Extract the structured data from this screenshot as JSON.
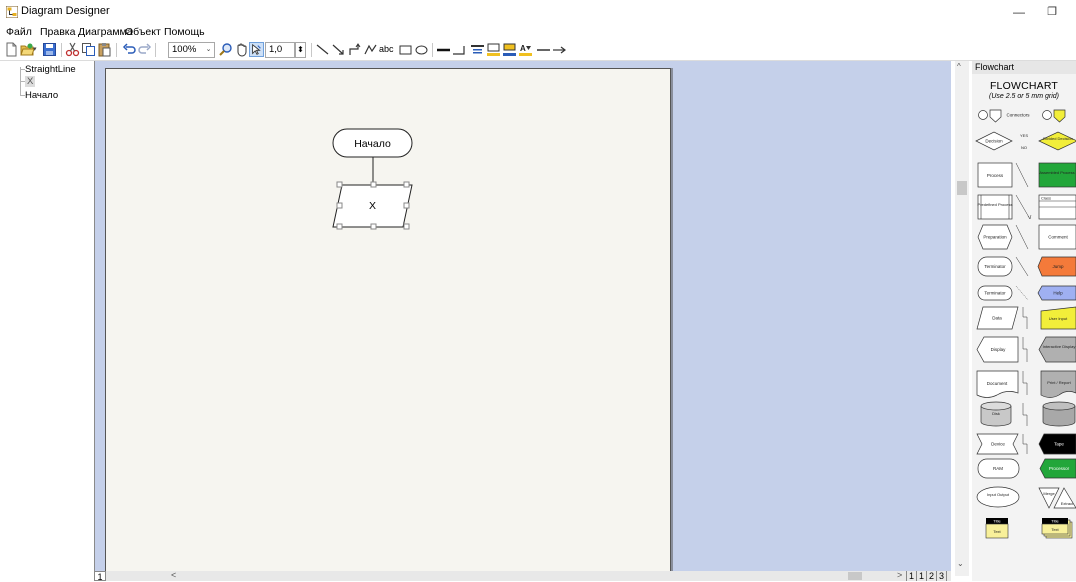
{
  "window": {
    "title": "Diagram Designer",
    "minimize_glyph": "—",
    "maximize_glyph": "❐"
  },
  "menu": [
    "Файл",
    "Правка",
    "Диаграмма",
    "Объект",
    "Помощь"
  ],
  "toolbar": {
    "zoom": "100%",
    "line_width": "1,0",
    "text_tool": "abc"
  },
  "tree": {
    "items": [
      "StraightLine",
      "X",
      "Начало"
    ]
  },
  "diagram": {
    "start_label": "Начало",
    "io_label": "X"
  },
  "pages": {
    "tab_1": "1",
    "tabs": [
      "1",
      "1",
      "2",
      "3"
    ]
  },
  "palette": {
    "header": "Flowchart",
    "title": "FLOWCHART",
    "subtitle": "(Use 2.5 or 5 mm grid)",
    "connectors": "Connectors",
    "yes": "YES",
    "no": "NO",
    "decision": "Decision",
    "divided_decision": "Divided Decision",
    "process": "Process",
    "assembled_process": "Assembled Process",
    "predefined_process": "Predefined Process",
    "class": "Class",
    "preparation": "Preparation",
    "comment": "Comment",
    "terminator": "Terminator",
    "jump": "Jump",
    "help": "Help",
    "data": "Data",
    "user_input": "User Input",
    "display": "Display",
    "interactive_display": "Interactive Display",
    "document": "Document",
    "print_report": "Print / Report",
    "disk": "Disk",
    "device": "Device",
    "tape": "Tape",
    "ram": "RAM",
    "processor": "Processor",
    "input_output": "Input Output",
    "merge": "Merge",
    "extract": "Extract",
    "title_label": "Title",
    "text_label": "Text"
  },
  "colors": {
    "canvas_bg": "#c5d0ea",
    "page_bg": "#f6f5f0",
    "green": "#22a63a",
    "yellow": "#f2ee3a",
    "orange": "#f47a3a",
    "blue": "#9fb0f2"
  }
}
